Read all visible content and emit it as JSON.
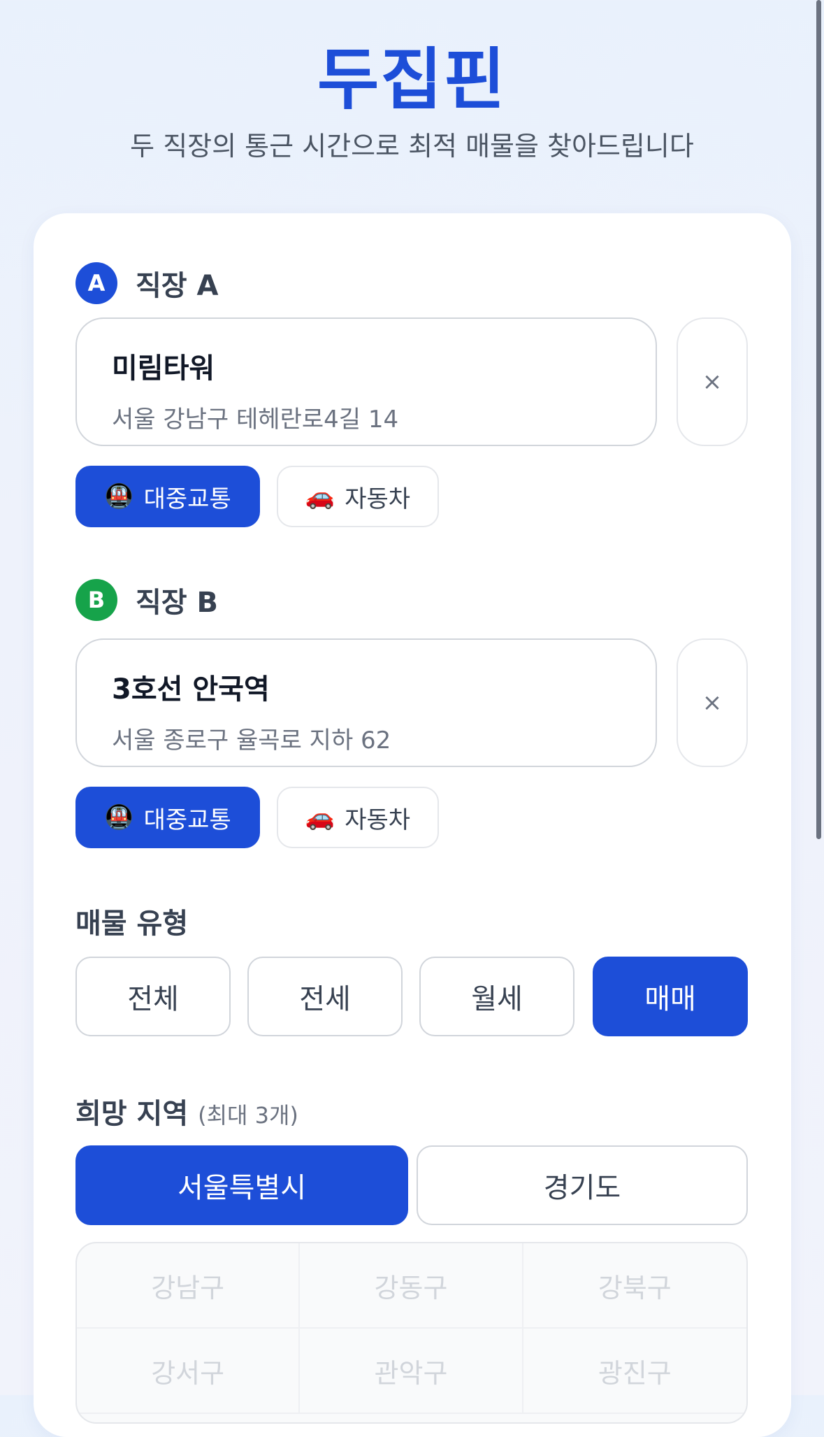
{
  "header": {
    "title": "두집핀",
    "subtitle": "두 직장의 통근 시간으로 최적 매물을 찾아드립니다"
  },
  "workplace_a": {
    "badge": "A",
    "label": "직장 A",
    "name": "미림타워",
    "address": "서울 강남구 테헤란로4길 14",
    "clear": "×",
    "modes": [
      {
        "icon": "🚇",
        "icon_name": "subway-icon",
        "label": "대중교통",
        "selected": true
      },
      {
        "icon": "🚗",
        "icon_name": "car-icon",
        "label": "자동차",
        "selected": false
      }
    ]
  },
  "workplace_b": {
    "badge": "B",
    "label": "직장 B",
    "name": "3호선 안국역",
    "address": "서울 종로구 율곡로 지하 62",
    "clear": "×",
    "modes": [
      {
        "icon": "🚇",
        "icon_name": "subway-icon",
        "label": "대중교통",
        "selected": true
      },
      {
        "icon": "🚗",
        "icon_name": "car-icon",
        "label": "자동차",
        "selected": false
      }
    ]
  },
  "property_type": {
    "title": "매물 유형",
    "options": [
      "전체",
      "전세",
      "월세",
      "매매"
    ],
    "selected": "매매"
  },
  "region": {
    "title": "희망 지역",
    "hint": "(최대 3개)",
    "tabs": [
      "서울특별시",
      "경기도"
    ],
    "selected": "서울특별시",
    "districts": [
      "강남구",
      "강동구",
      "강북구",
      "강서구",
      "관악구",
      "광진구"
    ]
  },
  "colors": {
    "accent": "#1d4ed8",
    "badge_b": "#16a34a",
    "disabled_text": "#d1d5db"
  }
}
